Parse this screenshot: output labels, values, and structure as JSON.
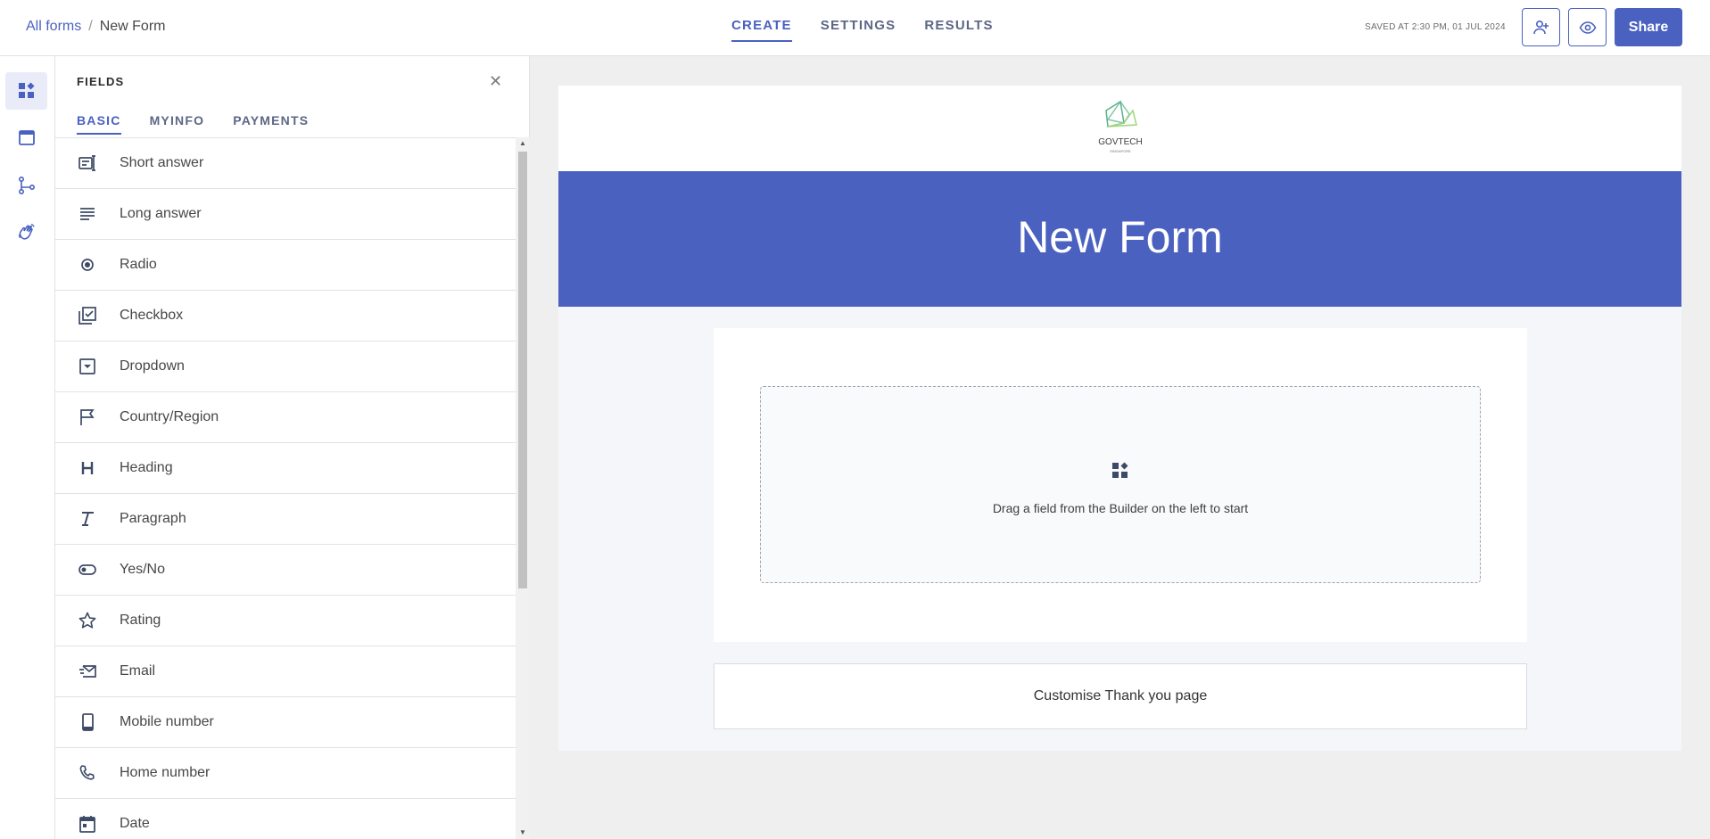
{
  "breadcrumb": {
    "root": "All forms",
    "separator": "/",
    "current": "New Form"
  },
  "nav_tabs": [
    "CREATE",
    "SETTINGS",
    "RESULTS"
  ],
  "saved_status": "SAVED AT 2:30 PM, 01 JUL 2024",
  "share_label": "Share",
  "panel": {
    "title": "FIELDS",
    "tabs": [
      "BASIC",
      "MYINFO",
      "PAYMENTS"
    ],
    "fields": [
      {
        "label": "Short answer",
        "icon": "short-answer-icon"
      },
      {
        "label": "Long answer",
        "icon": "long-answer-icon"
      },
      {
        "label": "Radio",
        "icon": "radio-icon"
      },
      {
        "label": "Checkbox",
        "icon": "checkbox-icon"
      },
      {
        "label": "Dropdown",
        "icon": "dropdown-icon"
      },
      {
        "label": "Country/Region",
        "icon": "flag-icon"
      },
      {
        "label": "Heading",
        "icon": "heading-icon"
      },
      {
        "label": "Paragraph",
        "icon": "paragraph-icon"
      },
      {
        "label": "Yes/No",
        "icon": "toggle-icon"
      },
      {
        "label": "Rating",
        "icon": "star-icon"
      },
      {
        "label": "Email",
        "icon": "email-icon"
      },
      {
        "label": "Mobile number",
        "icon": "mobile-icon"
      },
      {
        "label": "Home number",
        "icon": "phone-icon"
      },
      {
        "label": "Date",
        "icon": "calendar-icon"
      }
    ]
  },
  "form": {
    "logo_text": "GOVTECH",
    "logo_subtext": "SINGAPORE",
    "title": "New Form",
    "dropzone_text": "Drag a field from the Builder on the left to start",
    "thank_you_label": "Customise Thank you page"
  },
  "help_label": "?",
  "colors": {
    "primary": "#4a61c0",
    "banner": "#4a61c0"
  }
}
